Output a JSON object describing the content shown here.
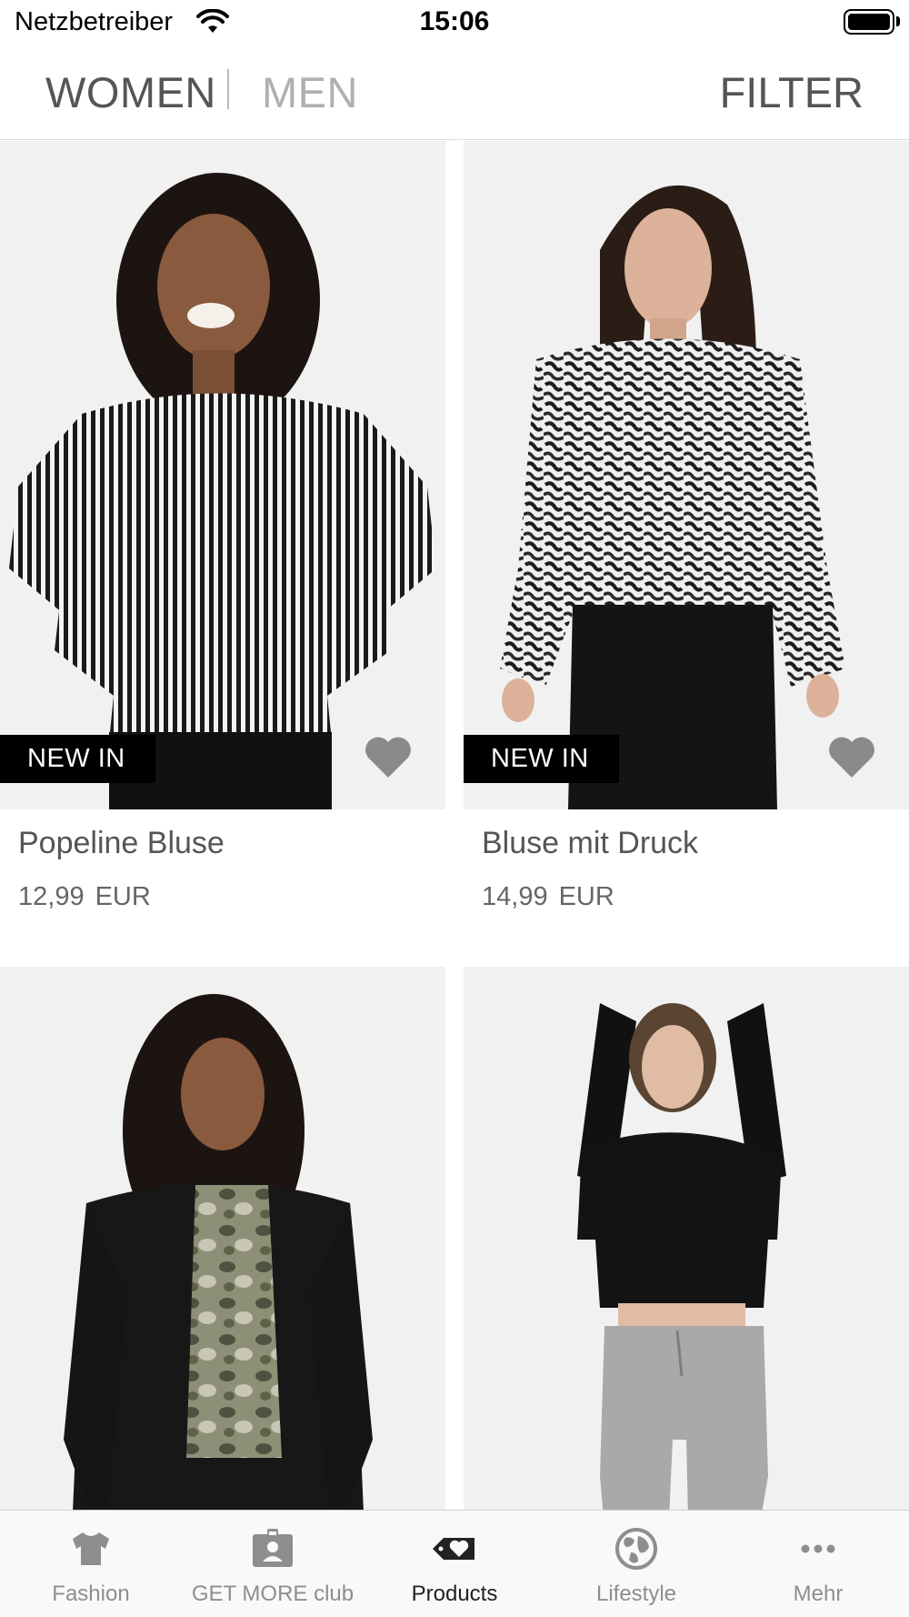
{
  "status_bar": {
    "carrier": "Netzbetreiber",
    "time": "15:06",
    "wifi_icon": "wifi-icon",
    "battery_icon": "battery-icon"
  },
  "header": {
    "tabs": [
      {
        "label": "WOMEN",
        "selected": true
      },
      {
        "label": "MEN",
        "selected": false
      }
    ],
    "filter_label": "FILTER"
  },
  "products": [
    {
      "name": "Popeline Bluse",
      "price": "12,99",
      "currency": "EUR",
      "badge": "NEW IN",
      "favorite_icon": "heart-icon"
    },
    {
      "name": "Bluse mit Druck",
      "price": "14,99",
      "currency": "EUR",
      "badge": "NEW IN",
      "favorite_icon": "heart-icon"
    },
    {
      "name": "",
      "price": "",
      "currency": "",
      "badge": "",
      "favorite_icon": ""
    },
    {
      "name": "",
      "price": "",
      "currency": "",
      "badge": "",
      "favorite_icon": ""
    }
  ],
  "tab_bar": {
    "items": [
      {
        "label": "Fashion",
        "icon": "tshirt-icon",
        "active": false
      },
      {
        "label": "GET MORE club",
        "icon": "member-card-icon",
        "active": false
      },
      {
        "label": "Products",
        "icon": "tag-heart-icon",
        "active": true
      },
      {
        "label": "Lifestyle",
        "icon": "globe-icon",
        "active": false
      },
      {
        "label": "Mehr",
        "icon": "more-icon",
        "active": false
      }
    ]
  },
  "colors": {
    "badge_bg": "#000000",
    "heart": "#8a8a8a",
    "tab_inactive": "#8e8e8e",
    "tab_active": "#222222"
  }
}
